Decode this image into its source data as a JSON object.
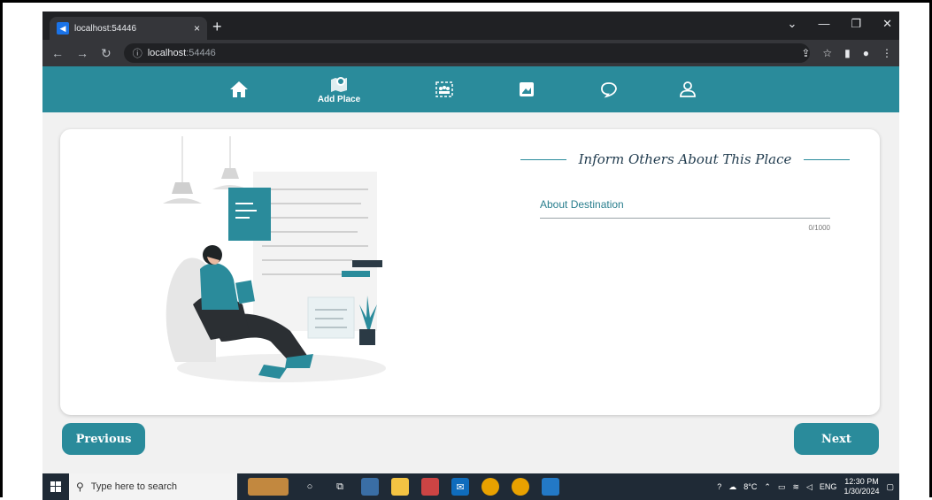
{
  "browser": {
    "tab_title": "localhost:54446",
    "tab_close": "×",
    "new_tab": "+",
    "window_controls": [
      "⌄",
      "—",
      "❐",
      "✕"
    ],
    "url_host": "localhost",
    "url_port": ":54446"
  },
  "nav": {
    "items": [
      {
        "icon": "home-icon"
      },
      {
        "icon": "map-pin-icon",
        "label": "Add Place"
      },
      {
        "icon": "group-icon"
      },
      {
        "icon": "swap-image-icon"
      },
      {
        "icon": "chat-bubble-icon"
      },
      {
        "icon": "user-icon"
      }
    ],
    "active_color": "#2a8b9b"
  },
  "form": {
    "heading": "Inform Others About This Place",
    "field_label": "About Destination",
    "counter": "0/1000"
  },
  "buttons": {
    "previous": "Previous",
    "next": "Next"
  },
  "taskbar": {
    "search_placeholder": "Type here to search",
    "temperature": "8°C",
    "language": "ENG",
    "time": "12:30 PM",
    "date": "1/30/2024"
  }
}
